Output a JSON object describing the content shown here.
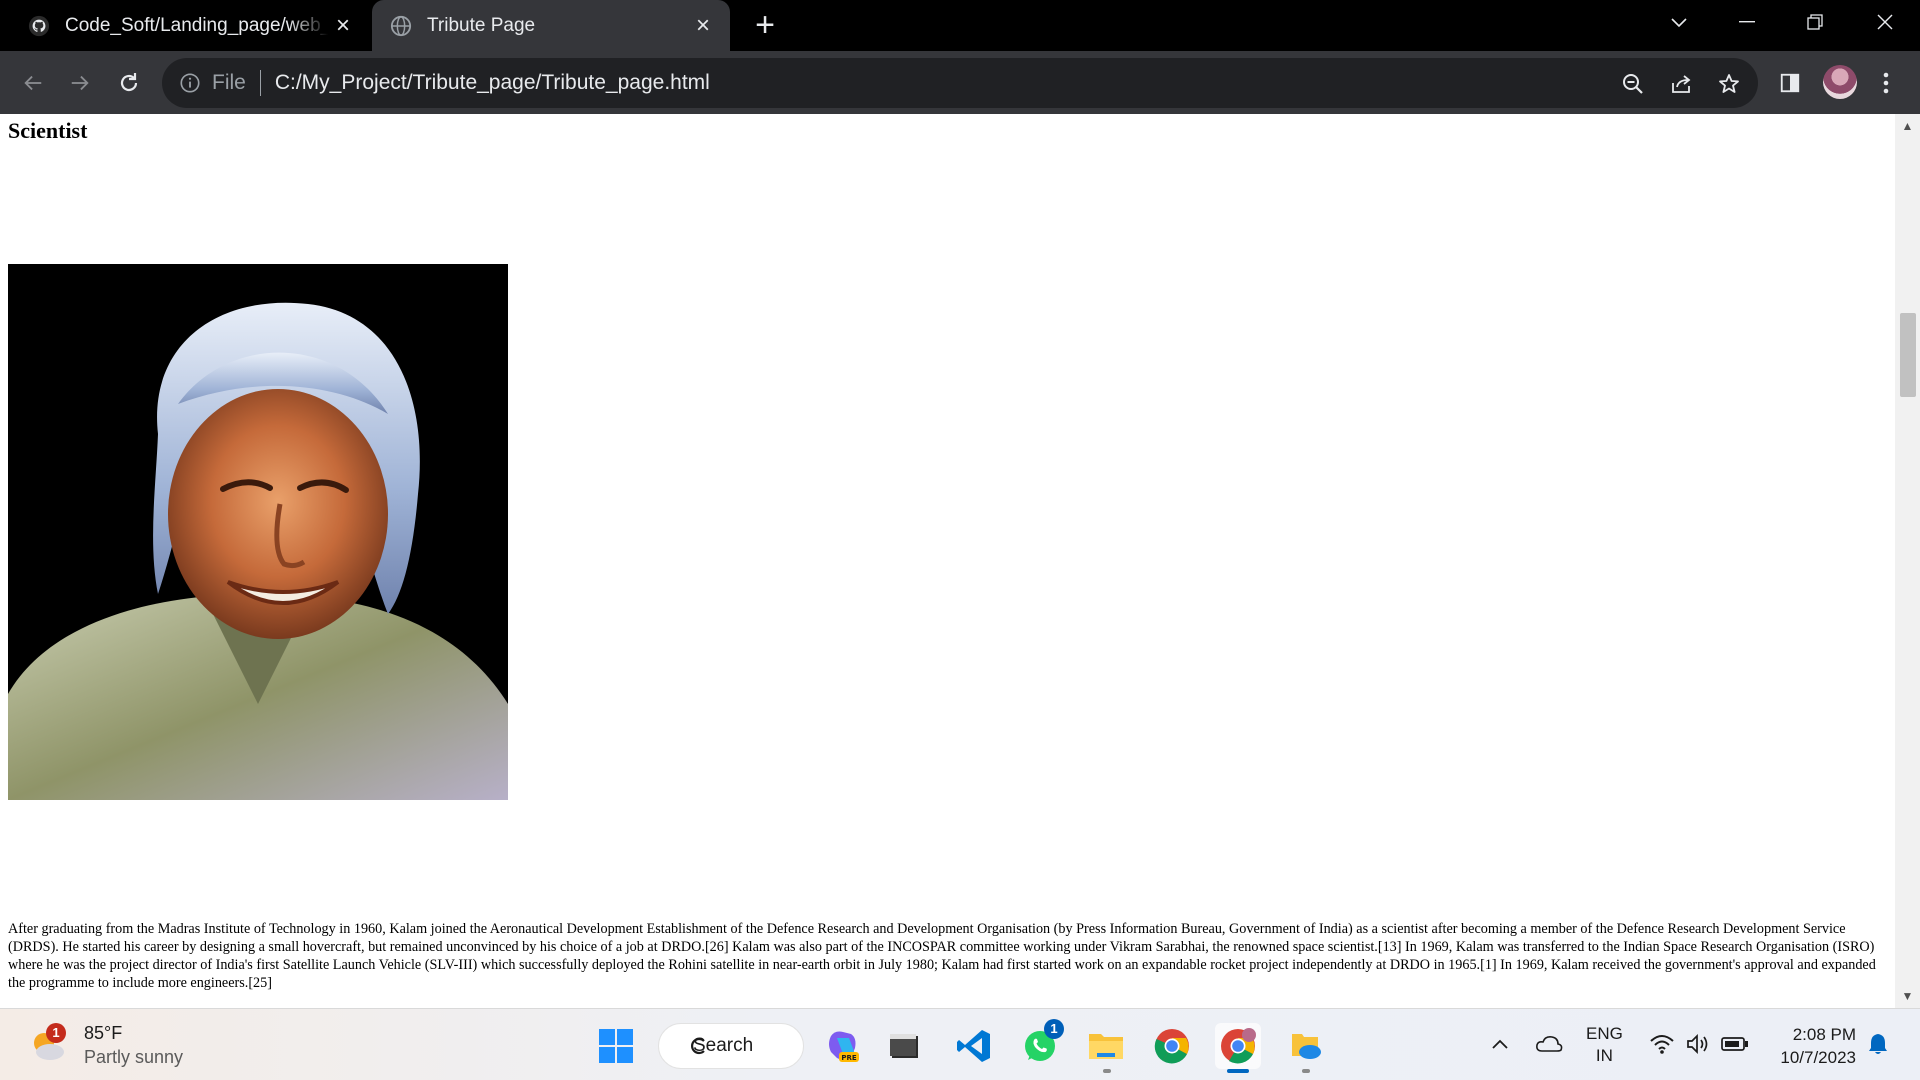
{
  "browser": {
    "tabs": [
      {
        "title": "Code_Soft/Landing_page/web_S",
        "favicon": "github-icon",
        "active": false
      },
      {
        "title": "Tribute Page",
        "favicon": "globe-icon",
        "active": true
      }
    ],
    "address": {
      "scheme_label": "File",
      "url": "C:/My_Project/Tribute_page/Tribute_page.html"
    }
  },
  "page": {
    "heading": "Scientist",
    "image_alt": "Portrait painting of the scientist",
    "paragraph": "After graduating from the Madras Institute of Technology in 1960, Kalam joined the Aeronautical Development Establishment of the Defence Research and Development Organisation (by Press Information Bureau, Government of India) as a scientist after becoming a member of the Defence Research Development Service (DRDS). He started his career by designing a small hovercraft, but remained unconvinced by his choice of a job at DRDO.[26] Kalam was also part of the INCOSPAR committee working under Vikram Sarabhai, the renowned space scientist.[13] In 1969, Kalam was transferred to the Indian Space Research Organisation (ISRO) where he was the project director of India's first Satellite Launch Vehicle (SLV-III) which successfully deployed the Rohini satellite in near-earth orbit in July 1980; Kalam had first started work on an expandable rocket project independently at DRDO in 1965.[1] In 1969, Kalam received the government's approval and expanded the programme to include more engineers.[25]"
  },
  "taskbar": {
    "weather": {
      "temp": "85°F",
      "condition": "Partly sunny",
      "badge": "1"
    },
    "search_label": "Search",
    "whatsapp_badge": "1",
    "language": {
      "line1": "ENG",
      "line2": "IN"
    },
    "clock": {
      "time": "2:08 PM",
      "date": "10/7/2023"
    }
  },
  "colors": {
    "tab_strip": "#000000",
    "toolbar": "#35363a",
    "omnibox": "#202124",
    "taskbar_accent": "#0067c0"
  }
}
